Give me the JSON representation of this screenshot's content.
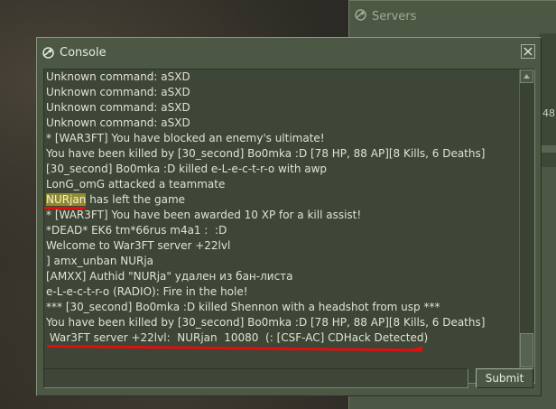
{
  "servers_window": {
    "title": "Servers",
    "partial_number": "48"
  },
  "console": {
    "title": "Console",
    "close_glyph": "✕",
    "log_lines": [
      {
        "text": "Unknown command: aSXD"
      },
      {
        "text": "Unknown command: aSXD"
      },
      {
        "text": "Unknown command: aSXD"
      },
      {
        "text": "Unknown command: aSXD"
      },
      {
        "text": "* [WAR3FT] You have blocked an enemy's ultimate!"
      },
      {
        "text": "You have been killed by [30_second] Bo0mka :D [78 HP, 88 AP][8 Kills, 6 Deaths]"
      },
      {
        "text": "[30_second] Bo0mka :D killed e-L-e-c-t-r-o with awp"
      },
      {
        "text": "LonG_omG attacked a teammate"
      },
      {
        "highlight": "NURjan",
        "text": " has left the game"
      },
      {
        "text": "* [WAR3FT] You have been awarded 10 XP for a kill assist!"
      },
      {
        "text": "*DEAD* EK6 tm*66rus m4a1 :  :D"
      },
      {
        "text": "Welcome to War3FT server +22lvl"
      },
      {
        "text": "] amx_unban NURja"
      },
      {
        "text": "[AMXX] Authid \"NURja\" удален из бан-листа"
      },
      {
        "text": "e-L-e-c-t-r-o (RADIO): Fire in the hole!"
      },
      {
        "text": "*** [30_second] Bo0mka :D killed Shennon with a headshot from usp ***"
      },
      {
        "text": "You have been killed by [30_second] Bo0mka :D [78 HP, 88 AP][8 Kills, 6 Deaths]"
      },
      {
        "text": " War3FT server +22lvl:  NURjan  10080  (: [CSF-AC] CDHack Detected)"
      }
    ],
    "input_value": "",
    "submit_label": "Submit"
  },
  "colors": {
    "panel": "#4c5844",
    "text": "#dfe4d4",
    "highlight": "#8f8a2d",
    "annotation": "#e01010"
  }
}
